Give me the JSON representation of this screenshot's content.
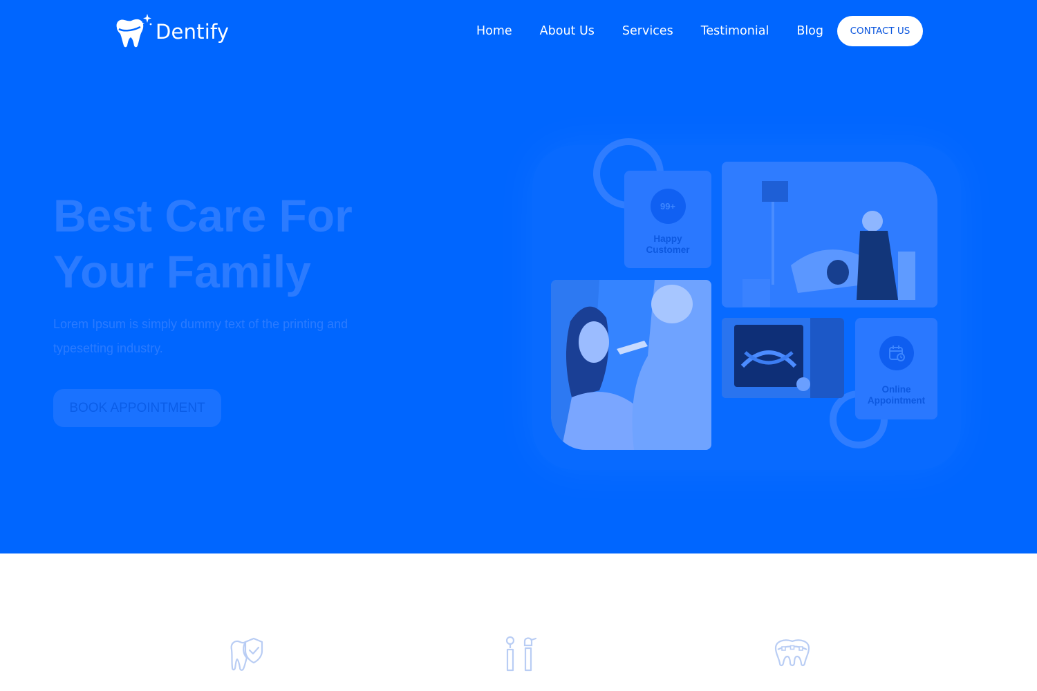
{
  "header": {
    "logo_text": "Dentify",
    "nav": [
      "Home",
      "About Us",
      "Services",
      "Testimonial",
      "Blog"
    ],
    "contact_label": "CONTACT US"
  },
  "hero": {
    "title_line1": "Best Care For",
    "title_line2": "Your Family",
    "description": "Lorem Ipsum is simply dummy text of the printing and typesetting industry.",
    "cta_label": "BOOK APPOINTMENT"
  },
  "collage": {
    "happy_count": "99+",
    "happy_label_1": "Happy",
    "happy_label_2": "Customer",
    "online_label_1": "Online",
    "online_label_2": "Appointment",
    "online_icon": "calendar-clock-icon"
  },
  "features": {
    "icons": [
      "tooth-shield-icon",
      "dental-tools-icon",
      "teeth-braces-icon"
    ]
  },
  "colors": {
    "hero_bg": "#0066ff",
    "accent_light": "#2b7bff",
    "white": "#ffffff",
    "icon_pale": "#b9cdf4"
  }
}
